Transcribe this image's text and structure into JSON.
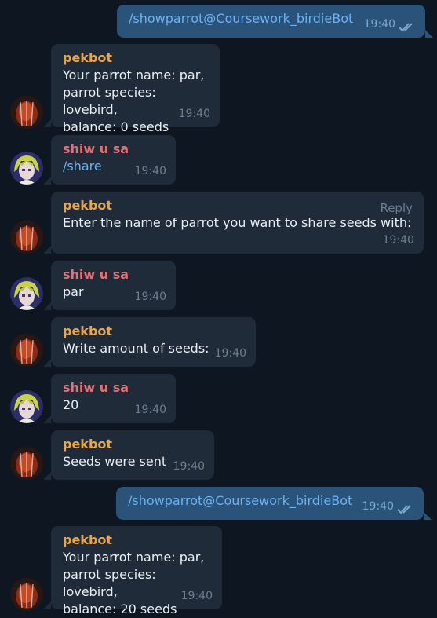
{
  "messages": [
    {
      "text": "/showparrot@Coursework_birdieBot",
      "time": "19:40"
    },
    {
      "sender": "pekbot",
      "text": "Your parrot name: par,\nparrot species: lovebird,\nbalance: 0 seeds",
      "time": "19:40"
    },
    {
      "sender": "shiw u sa",
      "text": "/share",
      "time": "19:40"
    },
    {
      "sender": "pekbot",
      "text": "Enter the name of parrot you want to share seeds with:",
      "time": "19:40",
      "reply_label": "Reply"
    },
    {
      "sender": "shiw u sa",
      "text": "par",
      "time": "19:40"
    },
    {
      "sender": "pekbot",
      "text": "Write amount of seeds:",
      "time": "19:40"
    },
    {
      "sender": "shiw u sa",
      "text": "20",
      "time": "19:40"
    },
    {
      "sender": "pekbot",
      "text": "Seeds were sent",
      "time": "19:40"
    },
    {
      "text": "/showparrot@Coursework_birdieBot",
      "time": "19:40"
    },
    {
      "sender": "pekbot",
      "text": "Your parrot name: par,\nparrot species: lovebird,\nbalance: 20 seeds",
      "time": "19:40"
    }
  ]
}
